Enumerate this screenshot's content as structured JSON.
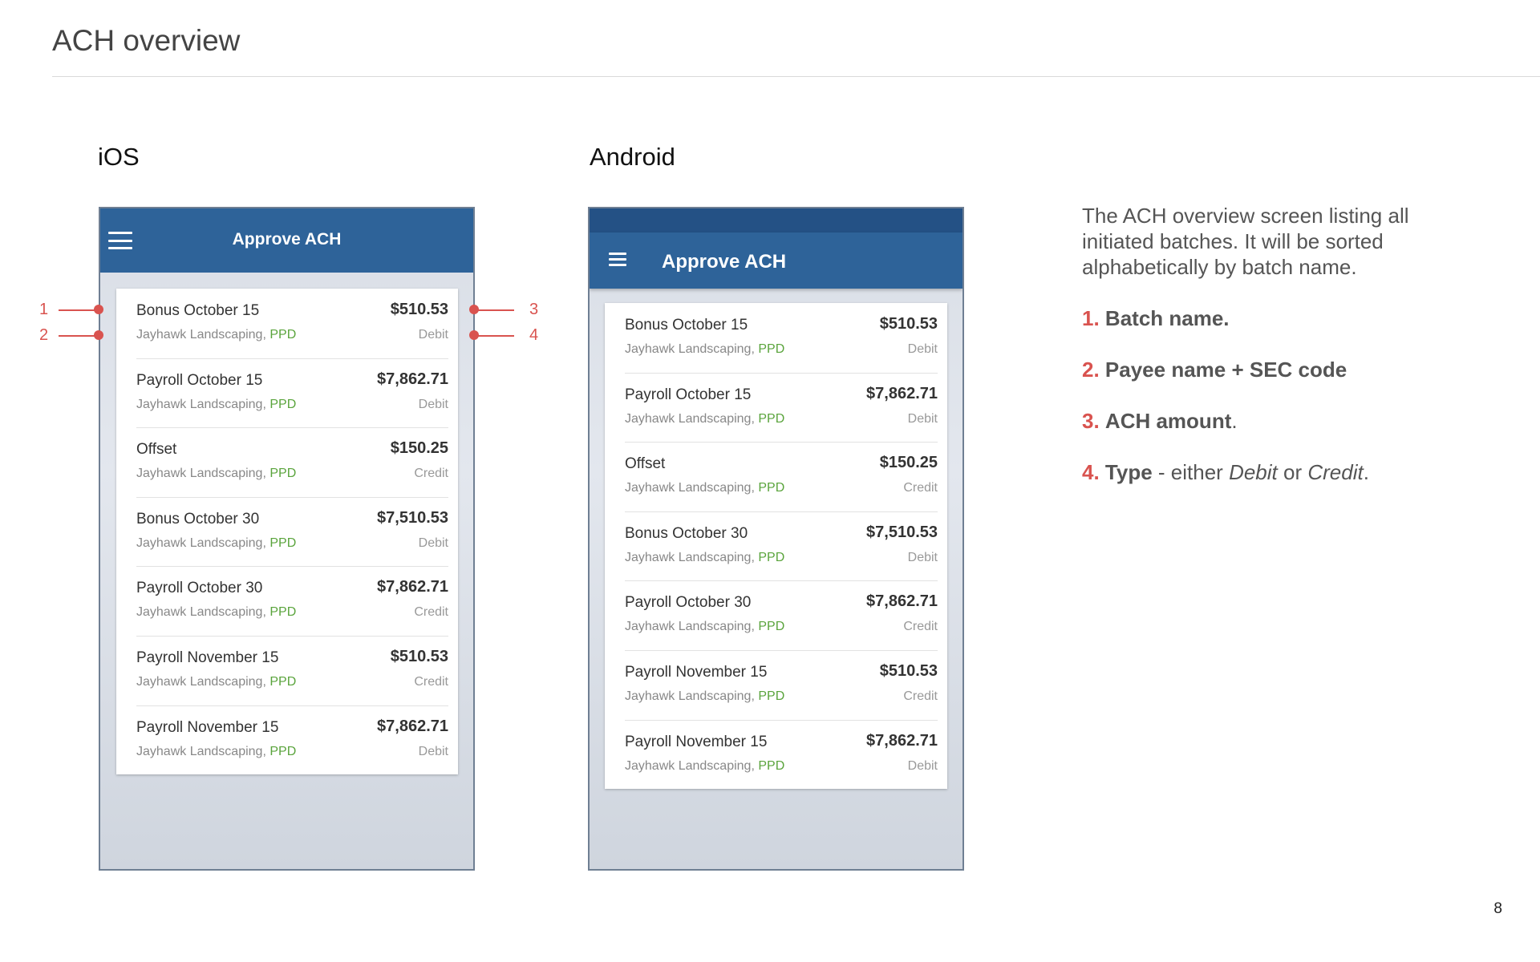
{
  "page": {
    "title": "ACH overview",
    "page_number": "8"
  },
  "platforms": {
    "ios": "iOS",
    "android": "Android"
  },
  "app": {
    "title": "Approve ACH"
  },
  "ach_rows": [
    {
      "name": "Bonus October 15",
      "payee": "Jayhawk Landscaping,",
      "sec": "PPD",
      "amount": "$510.53",
      "type": "Debit"
    },
    {
      "name": "Payroll October 15",
      "payee": "Jayhawk Landscaping,",
      "sec": "PPD",
      "amount": "$7,862.71",
      "type": "Debit"
    },
    {
      "name": "Offset",
      "payee": "Jayhawk Landscaping,",
      "sec": "PPD",
      "amount": "$150.25",
      "type": "Credit"
    },
    {
      "name": "Bonus October 30",
      "payee": "Jayhawk Landscaping,",
      "sec": "PPD",
      "amount": "$7,510.53",
      "type": "Debit"
    },
    {
      "name": "Payroll October 30",
      "payee": "Jayhawk Landscaping,",
      "sec": "PPD",
      "amount": "$7,862.71",
      "type": "Credit"
    },
    {
      "name": "Payroll November 15",
      "payee": "Jayhawk Landscaping,",
      "sec": "PPD",
      "amount": "$510.53",
      "type": "Credit"
    },
    {
      "name": "Payroll November 15",
      "payee": "Jayhawk Landscaping,",
      "sec": "PPD",
      "amount": "$7,862.71",
      "type": "Debit"
    }
  ],
  "callouts": [
    "1",
    "2",
    "3",
    "4"
  ],
  "description": {
    "intro": "The ACH overview screen listing all initiated batches. It will be sorted alphabetically by batch name.",
    "items": [
      {
        "num": "1.",
        "strong": "Batch name.",
        "rest": ""
      },
      {
        "num": "2.",
        "strong": "Payee name + SEC code",
        "rest": ""
      },
      {
        "num": "3.",
        "strong": "ACH amount",
        "rest": "."
      },
      {
        "num": "4.",
        "strong": "Type",
        "rest_prefix": " - either ",
        "em1": "Debit",
        "mid": " or ",
        "em2": "Credit",
        "rest_suffix": "."
      }
    ]
  },
  "colors": {
    "appbar": "#2e6399",
    "android_statusbar": "#245185",
    "callout": "#d9534f",
    "sec_code": "#5aa43c"
  }
}
